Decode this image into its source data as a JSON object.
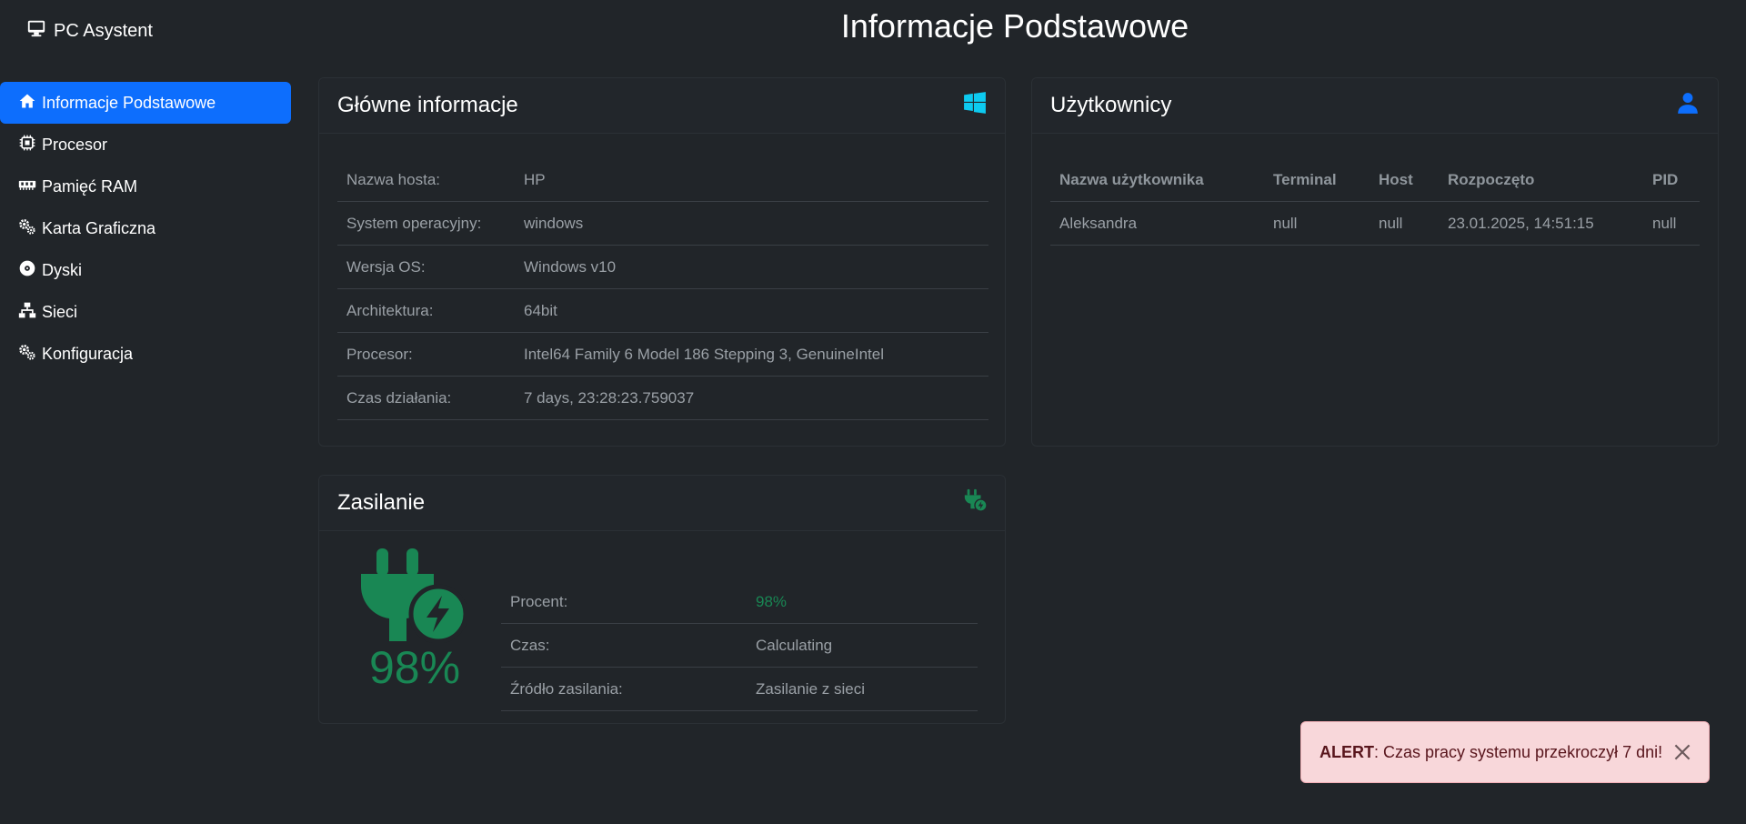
{
  "app": {
    "brand": "PC Asystent",
    "brand_icon": "monitor-icon",
    "page_title": "Informacje Podstawowe"
  },
  "sidebar": {
    "items": [
      {
        "label": "Informacje Podstawowe",
        "icon": "home-icon",
        "active": true
      },
      {
        "label": "Procesor",
        "icon": "cpu-icon"
      },
      {
        "label": "Pamięć RAM",
        "icon": "memory-icon"
      },
      {
        "label": "Karta Graficzna",
        "icon": "gears-icon"
      },
      {
        "label": "Dyski",
        "icon": "disc-icon"
      },
      {
        "label": "Sieci",
        "icon": "network-icon"
      },
      {
        "label": "Konfiguracja",
        "icon": "gears-icon"
      }
    ]
  },
  "main_info": {
    "title": "Główne informacje",
    "icon": "windows-icon",
    "rows": [
      {
        "label": "Nazwa hosta:",
        "value": "HP"
      },
      {
        "label": "System operacyjny:",
        "value": "windows"
      },
      {
        "label": "Wersja OS:",
        "value": "Windows v10"
      },
      {
        "label": "Architektura:",
        "value": "64bit"
      },
      {
        "label": "Procesor:",
        "value": "Intel64 Family 6 Model 186 Stepping 3, GenuineIntel"
      },
      {
        "label": "Czas działania:",
        "value": "7 days, 23:28:23.759037"
      }
    ]
  },
  "users": {
    "title": "Użytkownicy",
    "icon": "user-icon",
    "columns": [
      "Nazwa użytkownika",
      "Terminal",
      "Host",
      "Rozpoczęto",
      "PID"
    ],
    "rows": [
      [
        "Aleksandra",
        "null",
        "null",
        "23.01.2025, 14:51:15",
        "null"
      ]
    ]
  },
  "power": {
    "title": "Zasilanie",
    "icon": "plug-bolt-icon",
    "big_percent": "98%",
    "rows": [
      {
        "label": "Procent:",
        "value": "98%"
      },
      {
        "label": "Czas:",
        "value": "Calculating"
      },
      {
        "label": "Źródło zasilania:",
        "value": "Zasilanie z sieci"
      }
    ]
  },
  "alert": {
    "strong": "ALERT",
    "message": ": Czas pracy systemu przekroczył 7 dni!"
  },
  "colors": {
    "accent": "#0d6efd",
    "success": "#198754",
    "windows": "#0dcaf0",
    "alert_bg": "#f8d7da",
    "alert_text": "#58151c"
  }
}
